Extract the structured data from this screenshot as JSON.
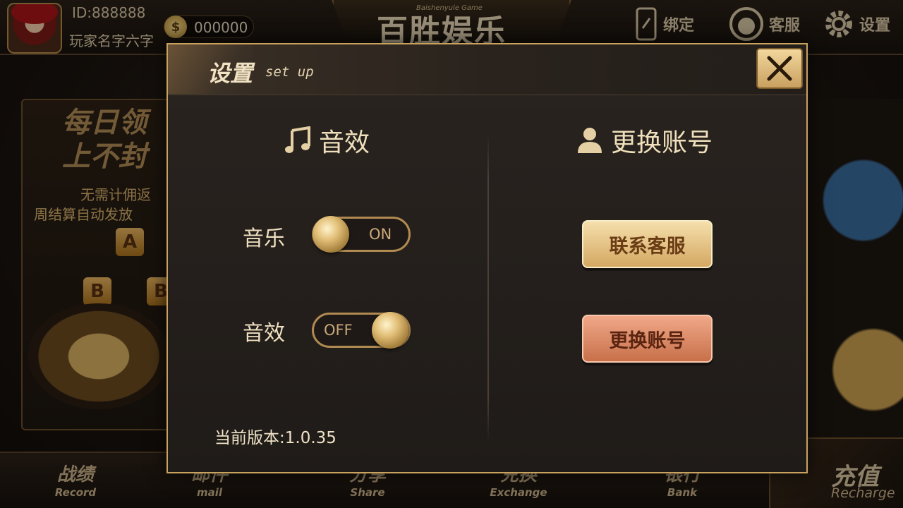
{
  "player": {
    "id_label": "ID:888888",
    "name": "玩家名字六字",
    "coins": "000000"
  },
  "header": {
    "logo_text": "百胜娱乐",
    "logo_sub": "Baishenyule Game",
    "bind_label": "绑定",
    "service_label": "客服",
    "settings_label": "设置"
  },
  "promo": {
    "line1": "每日领",
    "line2": "上不封",
    "desc1": "无需计佣返",
    "desc2": "周结算自动发放",
    "tier_a": "A",
    "tier_b1": "B",
    "tier_b2": "B"
  },
  "bottom_nav": [
    {
      "cn": "战绩",
      "en": "Record"
    },
    {
      "cn": "邮件",
      "en": "mail"
    },
    {
      "cn": "分享",
      "en": "Share"
    },
    {
      "cn": "兑换",
      "en": "Exchange"
    },
    {
      "cn": "银行",
      "en": "Bank"
    },
    {
      "cn": "充值",
      "en": "Recharge"
    }
  ],
  "dialog": {
    "title": "设置",
    "subtitle": "set up",
    "sound_section": "音效",
    "account_section": "更换账号",
    "music_label": "音乐",
    "music_state": "ON",
    "music_on": true,
    "sfx_label": "音效",
    "sfx_state": "OFF",
    "sfx_on": false,
    "contact_service_button": "联系客服",
    "switch_account_button": "更换账号",
    "version": "当前版本:1.0.35"
  },
  "colors": {
    "accent_gold": "#c9a25e",
    "dialog_bg": "#231e1a",
    "switch_button": "#c8704a"
  }
}
